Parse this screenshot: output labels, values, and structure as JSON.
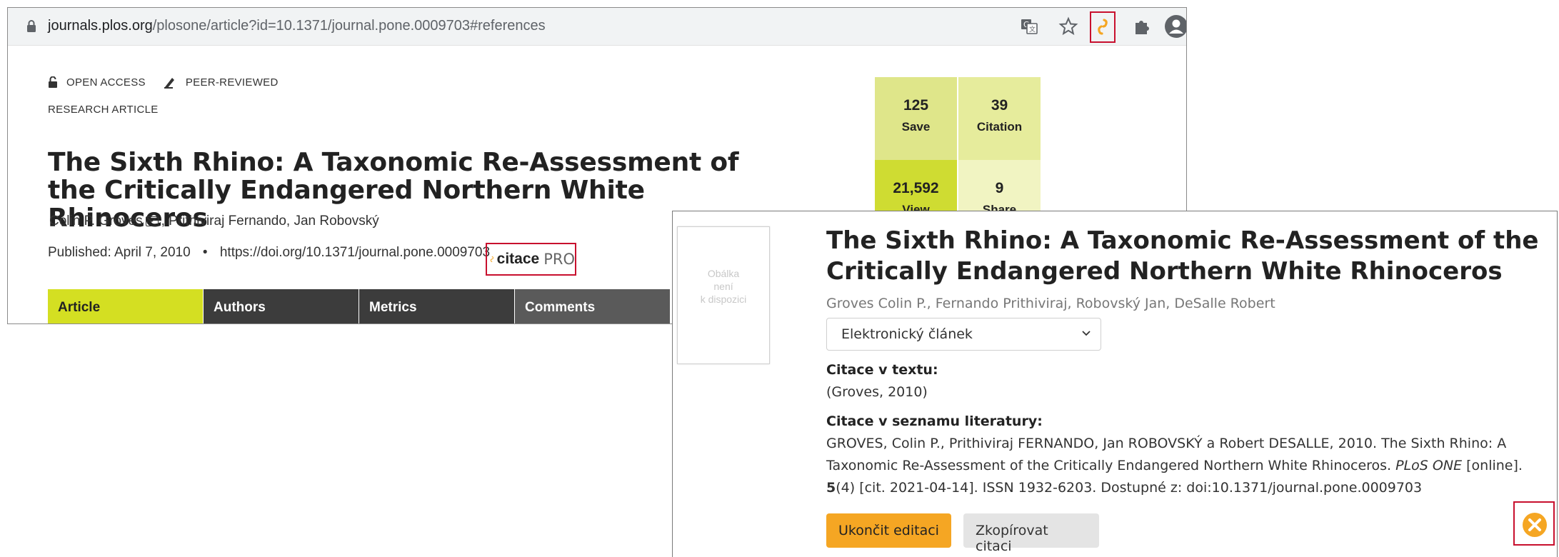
{
  "browser": {
    "url_host": "journals.plos.org",
    "url_path": "/plosone/article?id=10.1371/journal.pone.0009703#references"
  },
  "article": {
    "open_access": "OPEN ACCESS",
    "peer_reviewed": "PEER-REVIEWED",
    "article_type": "RESEARCH ARTICLE",
    "title": "The Sixth Rhino: A Taxonomic Re-Assessment of the Critically Endangered Northern White Rhinoceros",
    "author1": "Colin P. Groves",
    "authors_rest": ", Prithiviraj Fernando, Jan Robovský",
    "published": "Published: April 7, 2010",
    "bullet": "•",
    "doi": "https://doi.org/10.1371/journal.pone.0009703",
    "citace_label": "citace",
    "citace_pro": "PRO",
    "tabs": [
      "Article",
      "Authors",
      "Metrics",
      "Comments"
    ]
  },
  "metrics": [
    {
      "value": "125",
      "label": "Save",
      "color": "#dfe68a"
    },
    {
      "value": "39",
      "label": "Citation",
      "color": "#e6ec9c"
    },
    {
      "value": "21,592",
      "label": "View",
      "color": "#cfdc32"
    },
    {
      "value": "9",
      "label": "Share",
      "color": "#f1f4c2"
    }
  ],
  "popup": {
    "cover_text": [
      "Obálka",
      "není",
      "k dispozici"
    ],
    "title": "The Sixth Rhino: A Taxonomic Re-Assessment of the Critically Endangered Northern White Rhinoceros",
    "authors": "Groves Colin P., Fernando Prithiviraj, Robovský Jan, DeSalle Robert",
    "select_value": "Elektronický článek",
    "in_text_label": "Citace v textu:",
    "in_text_value": "(Groves, 2010)",
    "bib_label": "Citace v seznamu literatury:",
    "bib_part1": "GROVES, Colin P., Prithiviraj FERNANDO, Jan ROBOVSKÝ a Robert DESALLE, 2010. The Sixth Rhino: A Taxonomic Re-Assessment of the Critically Endangered Northern White Rhinoceros. ",
    "bib_journal": "PLoS ONE",
    "bib_part2": " [online]. ",
    "bib_volume": "5",
    "bib_part3": "(4) [cit. 2021-04-14]. ISSN 1932-6203. Dostupné z: doi:10.1371/journal.pone.0009703",
    "btn_finish": "Ukončit editaci",
    "btn_copy": "Zkopírovat citaci"
  },
  "colors": {
    "highlight_box": "#c8102e",
    "plos_green": "#d4df22",
    "button_orange": "#f5a623",
    "citace_orange": "#f5a623"
  },
  "icons": [
    "lock-icon",
    "translate-icon",
    "star-icon",
    "citace-extension-icon",
    "puzzle-icon",
    "profile-icon",
    "open-access-icon",
    "peer-reviewed-icon",
    "mail-icon",
    "citace-logo-icon",
    "chevron-down-icon",
    "close-icon"
  ]
}
